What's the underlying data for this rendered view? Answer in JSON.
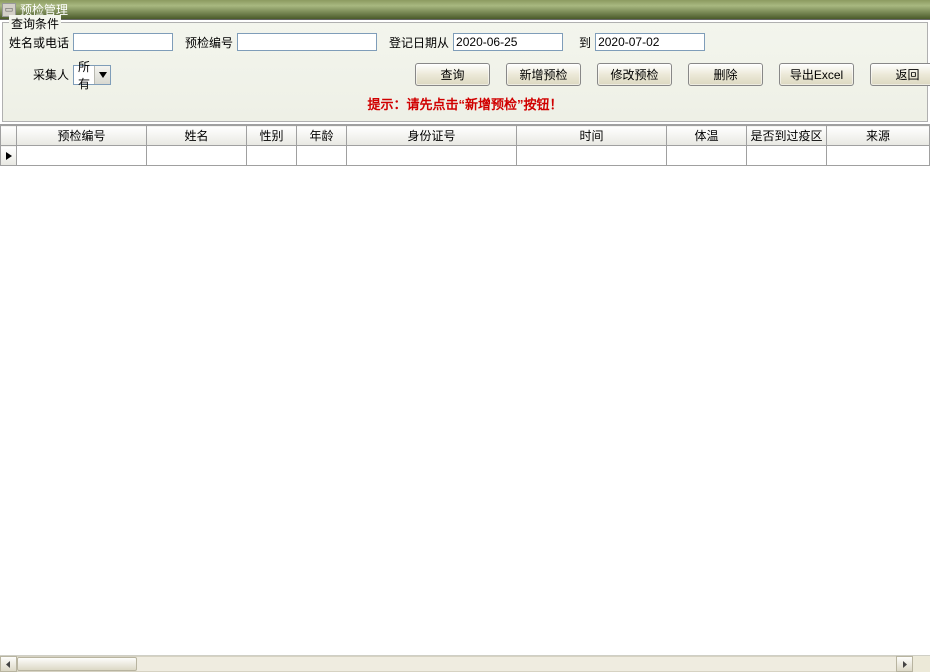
{
  "window": {
    "title": "预检管理"
  },
  "group": {
    "label": "查询条件"
  },
  "labels": {
    "name_or_phone": "姓名或电话",
    "precheck_no": "预检编号",
    "reg_date_from": "登记日期从",
    "to": "到",
    "collector": "采集人"
  },
  "fields": {
    "name_or_phone": "",
    "precheck_no": "",
    "date_from": "2020-06-25",
    "date_to": "2020-07-02",
    "collector": "所有"
  },
  "buttons": {
    "query": "查询",
    "add": "新增预检",
    "edit": "修改预检",
    "delete": "删除",
    "export": "导出Excel",
    "back": "返回"
  },
  "hint": "提示：请先点击“新增预检”按钮！",
  "columns": {
    "c0": "",
    "c1": "预检编号",
    "c2": "姓名",
    "c3": "性别",
    "c4": "年龄",
    "c5": "身份证号",
    "c6": "时间",
    "c7": "体温",
    "c8": "是否到过疫区",
    "c9": "来源"
  }
}
